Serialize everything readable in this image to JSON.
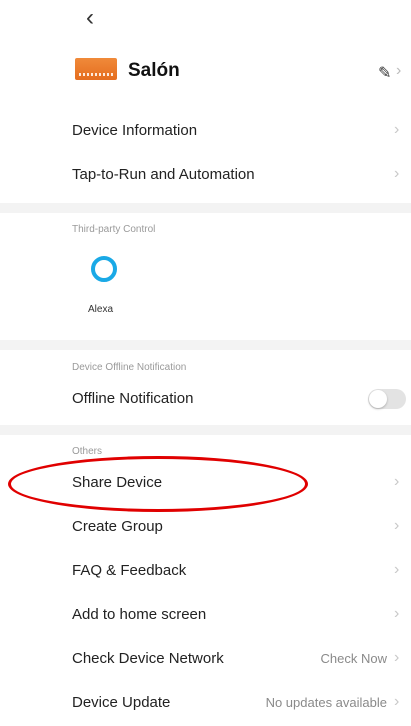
{
  "header": {
    "back_icon": "chevron-left-icon"
  },
  "device": {
    "name": "Salón",
    "thumbnail_color": "#f08a3a",
    "edit_icon": "pencil-icon"
  },
  "rows_top": [
    {
      "label": "Device Information"
    },
    {
      "label": "Tap-to-Run and Automation"
    }
  ],
  "third_party": {
    "section_label": "Third-party Control",
    "alexa_label": "Alexa",
    "alexa_color": "#1aa9e6"
  },
  "offline": {
    "section_label": "Device Offline Notification",
    "row_label": "Offline Notification",
    "toggle_on": false
  },
  "others": {
    "section_label": "Others",
    "rows": [
      {
        "label": "Share Device"
      },
      {
        "label": "Create Group"
      },
      {
        "label": "FAQ & Feedback"
      },
      {
        "label": "Add to home screen"
      },
      {
        "label": "Check Device Network",
        "value": "Check Now"
      },
      {
        "label": "Device Update",
        "value": "No updates available"
      }
    ]
  },
  "annotation": {
    "color": "#e00000",
    "target": "Share Device"
  }
}
